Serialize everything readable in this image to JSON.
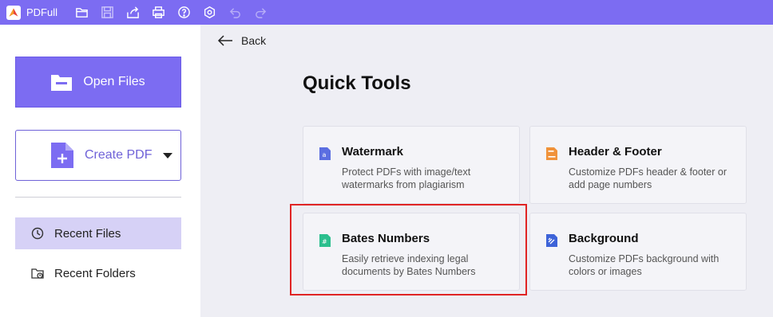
{
  "app": {
    "title": "PDFull"
  },
  "toolbar": {
    "icons": [
      "folder-open-icon",
      "save-icon",
      "share-icon",
      "print-icon",
      "help-icon",
      "settings-icon",
      "undo-icon",
      "redo-icon"
    ]
  },
  "sidebar": {
    "open_files_label": "Open Files",
    "create_pdf_label": "Create PDF",
    "items": [
      {
        "label": "Recent Files",
        "active": true,
        "icon": "clock-icon"
      },
      {
        "label": "Recent Folders",
        "active": false,
        "icon": "folder-clock-icon"
      }
    ]
  },
  "main": {
    "back_label": "Back",
    "title": "Quick Tools",
    "tools": [
      {
        "title": "Watermark",
        "desc": "Protect PDFs with image/text watermarks from plagiarism",
        "icon": "watermark-icon",
        "color": "#5b6ee1"
      },
      {
        "title": "Header & Footer",
        "desc": "Customize PDFs header & footer or add page numbers",
        "icon": "header-footer-icon",
        "color": "#f0923a"
      },
      {
        "title": "Bates Numbers",
        "desc": "Easily retrieve indexing legal documents by Bates Numbers",
        "icon": "bates-numbers-icon",
        "color": "#2bbf8e"
      },
      {
        "title": "Background",
        "desc": "Customize PDFs background with colors or images",
        "icon": "background-icon",
        "color": "#3d63d8"
      }
    ]
  },
  "colors": {
    "accent": "#7c6cf2",
    "highlight": "#e02424"
  }
}
